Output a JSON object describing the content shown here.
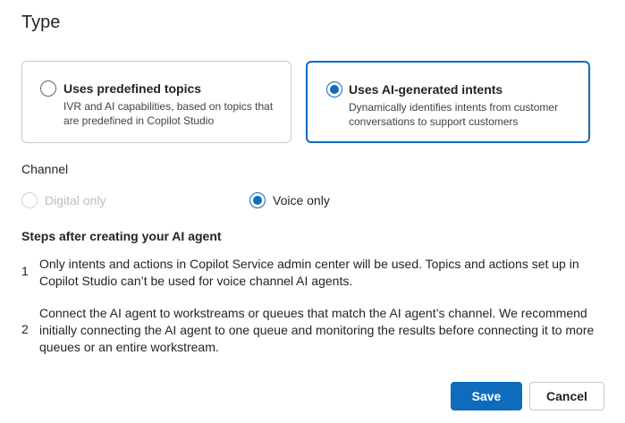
{
  "dialog": {
    "title": "Type"
  },
  "type_options": [
    {
      "label": "Uses predefined topics",
      "description": "IVR and AI capabilities, based on topics that are predefined in Copilot Studio",
      "selected": false
    },
    {
      "label": "Uses AI-generated intents",
      "description": "Dynamically identifies intents from customer conversations to support customers",
      "selected": true
    }
  ],
  "channel": {
    "label": "Channel",
    "options": [
      {
        "label": "Digital only",
        "selected": false,
        "disabled": true
      },
      {
        "label": "Voice only",
        "selected": true,
        "disabled": false
      }
    ]
  },
  "steps": {
    "heading": "Steps after creating your AI agent",
    "items": [
      {
        "number": "1",
        "text": "Only intents and actions in Copilot Service admin center will be used. Topics and actions set up in Copilot Studio can’t be used for voice channel AI agents."
      },
      {
        "number": "2",
        "text": "Connect the AI agent to workstreams or queues that match the AI agent’s channel. We recommend initially connecting the AI agent to one queue and monitoring the results before connecting it to more queues or an entire workstream."
      }
    ]
  },
  "footer": {
    "save_label": "Save",
    "cancel_label": "Cancel"
  },
  "colors": {
    "accent": "#0f6cbd",
    "text": "#242424",
    "disabled": "#bdbdbd"
  }
}
